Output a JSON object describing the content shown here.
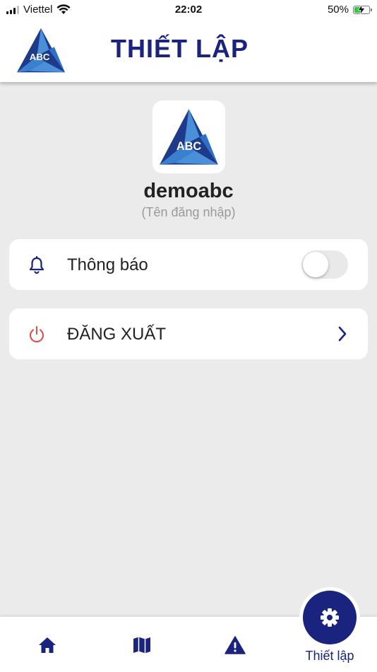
{
  "status_bar": {
    "carrier": "Viettel",
    "time": "22:02",
    "battery_percent": "50%",
    "battery_level": 0.5,
    "charging": true
  },
  "header": {
    "logo_text": "ABC",
    "title": "THIẾT LẬP"
  },
  "profile": {
    "logo_text": "ABC",
    "username": "demoabc",
    "username_caption": "(Tên đăng nhập)"
  },
  "settings": {
    "notifications": {
      "label": "Thông báo",
      "icon": "bell-icon",
      "enabled": false
    },
    "logout": {
      "label": "ĐĂNG XUẤT",
      "icon": "power-icon"
    }
  },
  "bottom_nav": {
    "items": [
      {
        "icon": "home-icon"
      },
      {
        "icon": "map-icon"
      },
      {
        "icon": "warning-icon"
      },
      {
        "icon": "gear-icon",
        "label": "Thiết lập",
        "active": true
      }
    ]
  },
  "colors": {
    "primary": "#1a237e",
    "logo_light": "#4a90d9",
    "logo_dark": "#1e3a8a",
    "logout_icon": "#d9534f",
    "background": "#ebebeb"
  }
}
